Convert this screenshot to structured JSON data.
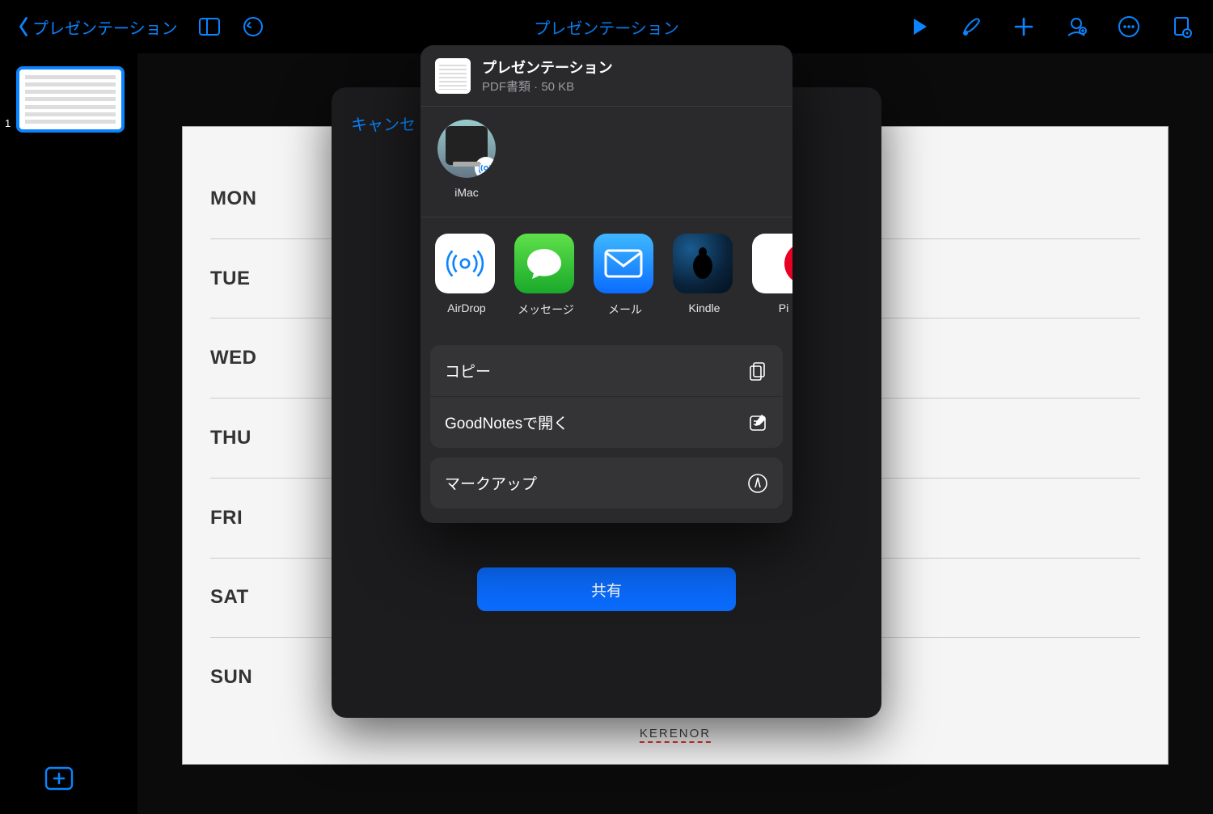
{
  "toolbar": {
    "back_label": "プレゼンテーション",
    "title": "プレゼンテーション"
  },
  "navigator": {
    "slide_number": "1"
  },
  "slide": {
    "days": [
      "MON",
      "TUE",
      "WED",
      "THU",
      "FRI",
      "SAT",
      "SUN"
    ],
    "footer": "KERENOR"
  },
  "export_sheet": {
    "cancel": "キャンセ",
    "share_button": "共有"
  },
  "share": {
    "doc_name": "プレゼンテーション",
    "doc_meta": "PDF書類 · 50 KB",
    "airdrop_target": "iMac",
    "apps": {
      "airdrop": "AirDrop",
      "messages": "メッセージ",
      "mail": "メール",
      "kindle": "Kindle",
      "pi": "Pi"
    },
    "actions": {
      "copy": "コピー",
      "goodnotes": "GoodNotesで開く",
      "markup": "マークアップ"
    }
  }
}
